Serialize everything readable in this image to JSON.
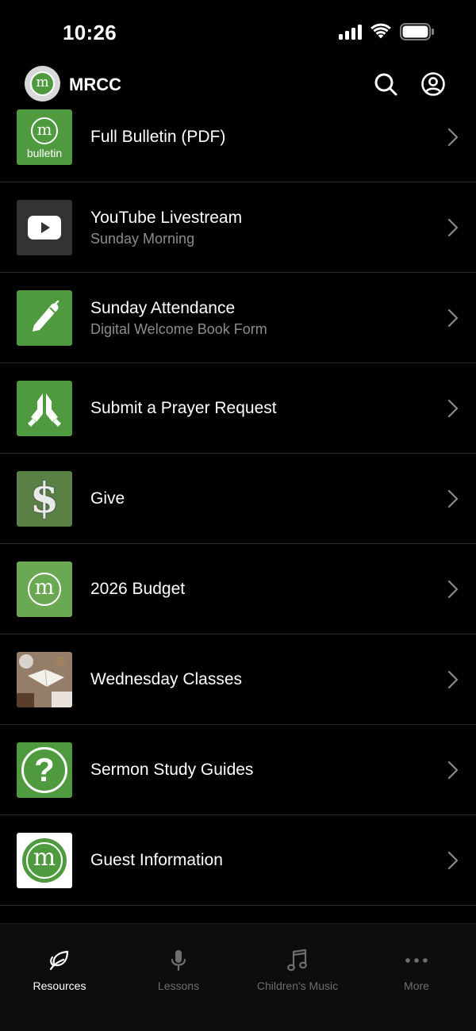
{
  "status_bar": {
    "time": "10:26"
  },
  "header": {
    "title": "MRCC",
    "logo_letter": "m"
  },
  "list_items": [
    {
      "title": "Full Bulletin (PDF)",
      "subtitle": "",
      "thumb_text": "bulletin",
      "thumb_letter": "m",
      "icon": "bulletin-logo"
    },
    {
      "title": "YouTube Livestream",
      "subtitle": "Sunday Morning",
      "icon": "youtube-icon"
    },
    {
      "title": "Sunday Attendance",
      "subtitle": "Digital Welcome Book Form",
      "icon": "pen-icon"
    },
    {
      "title": "Submit a Prayer Request",
      "subtitle": "",
      "icon": "praying-hands-icon"
    },
    {
      "title": "Give",
      "subtitle": "",
      "icon": "dollar-icon"
    },
    {
      "title": "2026 Budget",
      "subtitle": "",
      "thumb_letter": "m",
      "icon": "church-logo"
    },
    {
      "title": "Wednesday Classes",
      "subtitle": "",
      "icon": "classes-photo"
    },
    {
      "title": "Sermon Study Guides",
      "subtitle": "",
      "icon": "question-icon"
    },
    {
      "title": "Guest Information",
      "subtitle": "",
      "thumb_letter": "m",
      "icon": "church-logo"
    }
  ],
  "tabs": [
    {
      "label": "Resources",
      "icon": "leaf-icon",
      "active": true
    },
    {
      "label": "Lessons",
      "icon": "microphone-icon",
      "active": false
    },
    {
      "label": "Children's Music",
      "icon": "music-note-icon",
      "active": false
    },
    {
      "label": "More",
      "icon": "ellipsis-icon",
      "active": false
    }
  ],
  "colors": {
    "background": "#000000",
    "brand_green": "#4f9a3f",
    "subtitle_gray": "#8c8c8c",
    "inactive_tab": "#6e6e6e"
  }
}
